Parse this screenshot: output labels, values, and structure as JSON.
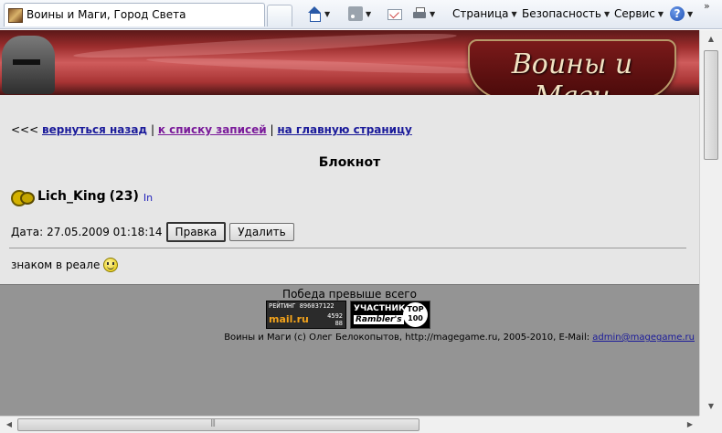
{
  "browser": {
    "tab_title": "Воины и Маги, Город Света",
    "chevron": "»",
    "toolbar": {
      "page_label": "Страница",
      "safety_label": "Безопасность",
      "tools_label": "Сервис",
      "help_glyph": "?"
    }
  },
  "banner": {
    "logo_text": "Воины и Маги"
  },
  "page": {
    "nav": {
      "prefix": "<<<",
      "back_label": "вернуться назад",
      "sep1": "|",
      "list_label": "к списку записей",
      "sep2": "|",
      "home_label": "на главную страницу"
    },
    "heading": "Блокнот",
    "user": {
      "name": "Lich_King",
      "level": "(23)",
      "info": "In"
    },
    "entry": {
      "date_label": "Дата:",
      "date_value": "27.05.2009 01:18:14",
      "edit_label": "Правка",
      "delete_label": "Удалить",
      "text": "знаком в реале"
    }
  },
  "footer": {
    "motto": "Победа превыше всего",
    "mail_counter": {
      "top": "РЕЙТИНГ 896037122",
      "brand": "mail.ru",
      "n1": "4592",
      "n2": "88"
    },
    "rambler_counter": {
      "line1": "УЧАСТНИК",
      "line2": "Rambler's",
      "top_line1": "TOP",
      "top_line2": "100"
    },
    "copyright": "Воины и Маги (c) Олег Белокопытов, http://magegame.ru, 2005-2010, E-Mail:",
    "email": "admin@magegame.ru"
  },
  "colors": {
    "link": "#1a1a9a",
    "visited_link": "#7a1a9a",
    "footer_bg": "#949494",
    "content_bg": "#e6e6e6"
  },
  "icons": {
    "home": "home-icon",
    "feeds": "rss-icon",
    "mail": "mail-icon",
    "print": "print-icon",
    "help": "help-icon"
  }
}
